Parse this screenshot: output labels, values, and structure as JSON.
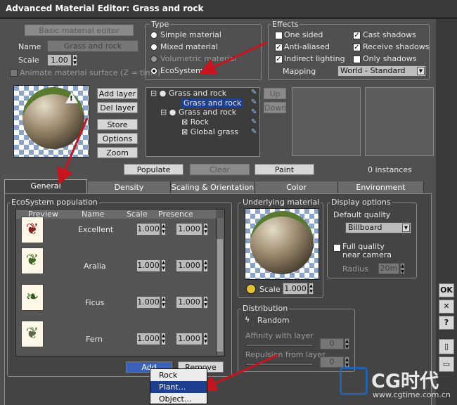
{
  "window": {
    "title": "Advanced Material Editor: Grass and rock"
  },
  "top": {
    "basic_editor_btn": "Basic material editor",
    "name_label": "Name",
    "name_value": "Grass and rock",
    "scale_label": "Scale",
    "scale_value": "1.00",
    "animate_label": "Animate material surface (Z = time)"
  },
  "type": {
    "title": "Type",
    "options": [
      "Simple material",
      "Mixed material",
      "Volumetric material",
      "EcoSystem"
    ],
    "selected": "EcoSystem"
  },
  "effects": {
    "title": "Effects",
    "one_sided": "One sided",
    "cast_shadows": "Cast shadows",
    "anti_aliased": "Anti-aliased",
    "receive_shadows": "Receive shadows",
    "indirect_lighting": "Indirect lighting",
    "only_shadows": "Only shadows",
    "mapping_label": "Mapping",
    "mapping_value": "World - Standard"
  },
  "layer_buttons": {
    "add": "Add layer",
    "del": "Del layer",
    "store": "Store",
    "options": "Options",
    "zoom": "Zoom",
    "up": "Up",
    "down": "Down"
  },
  "tree": [
    "Grass and rock",
    "Grass and rock",
    "Grass and rock",
    "Rock",
    "Global grass"
  ],
  "actions": {
    "populate": "Populate",
    "clear": "Clear",
    "paint": "Paint",
    "instances": "0 instances"
  },
  "tabs": [
    "General",
    "Density",
    "Scaling & Orientation",
    "Color",
    "Environment"
  ],
  "eco": {
    "title": "EcoSystem population",
    "cols": [
      "Preview",
      "Name",
      "Scale",
      "Presence"
    ],
    "rows": [
      {
        "name": "Excellent",
        "scale": "1.000",
        "presence": "1.000"
      },
      {
        "name": "Aralia",
        "scale": "1.000",
        "presence": "1.000"
      },
      {
        "name": "Ficus",
        "scale": "1.000",
        "presence": "1.000"
      },
      {
        "name": "Fern",
        "scale": "1.000",
        "presence": "1.000"
      }
    ],
    "add": "Add",
    "remove": "Remove"
  },
  "underlying": {
    "title": "Underlying material",
    "scale_label": "Scale",
    "scale_value": "1.000"
  },
  "display": {
    "title": "Display options",
    "default_quality": "Default quality",
    "quality_value": "Billboard",
    "full_quality": "Full quality near camera",
    "radius_label": "Radius",
    "radius_value": "20m"
  },
  "distribution": {
    "title": "Distribution",
    "random": "Random",
    "affinity": "Affinity with layer",
    "affinity_value": "0",
    "repulsion": "Repulsion from layer",
    "repulsion_value": "0"
  },
  "context_menu": [
    "Rock",
    "Plant...",
    "Object..."
  ],
  "side_buttons": [
    "OK",
    "✕",
    "?"
  ],
  "watermark": {
    "brand": "CG时代",
    "url": "www.cgtime.com.cn"
  }
}
